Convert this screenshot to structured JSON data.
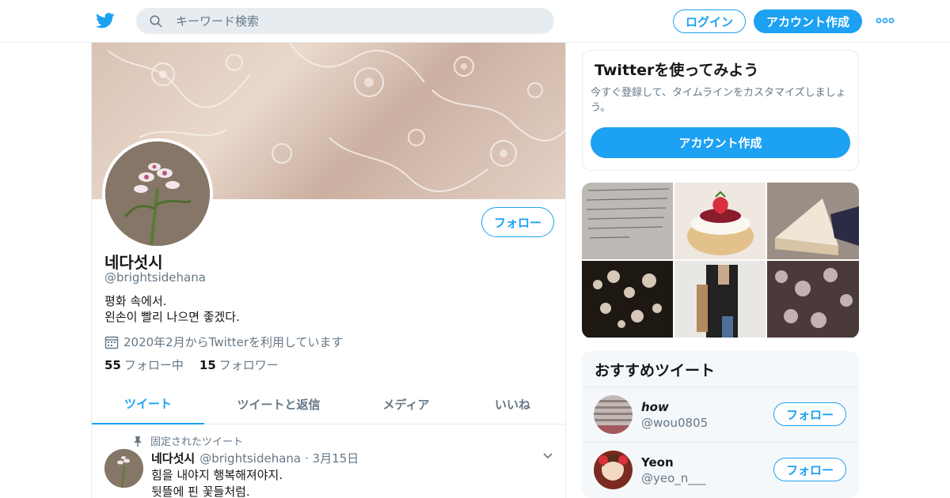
{
  "header": {
    "search_placeholder": "キーワード検索",
    "login_label": "ログイン",
    "signup_label": "アカウント作成"
  },
  "profile": {
    "name": "네다섯시",
    "handle": "@brightsidehana",
    "bio_line1": "평화 속에서.",
    "bio_line2": "왼손이 빨리 나으면 좋겠다.",
    "joined": "2020年2月からTwitterを利用しています",
    "following_count": "55",
    "following_label": "フォロー中",
    "followers_count": "15",
    "followers_label": "フォロワー",
    "follow_label": "フォロー"
  },
  "tabs": [
    {
      "label": "ツイート"
    },
    {
      "label": "ツイートと返信"
    },
    {
      "label": "メディア"
    },
    {
      "label": "いいね"
    }
  ],
  "pinned_tweet": {
    "pinned_label": "固定されたツイート",
    "name": "네다섯시",
    "handle": "@brightsidehana",
    "date": "· 3月15日",
    "line1": "힘을 내야지 행복해져야지.",
    "line2": "뒷뜰에 핀 꽃들처럼."
  },
  "signup_card": {
    "title": "Twitterを使ってみよう",
    "desc": "今すぐ登録して、タイムラインをカスタマイズしましょう。",
    "button": "アカウント作成"
  },
  "recommend": {
    "title": "おすすめツイート",
    "users": [
      {
        "name": "𝙝𝙤𝙬",
        "handle": "@wou0805",
        "follow_label": "フォロー"
      },
      {
        "name": "Yeon",
        "handle": "@yeo_n___",
        "follow_label": "フォロー"
      }
    ]
  },
  "colors": {
    "accent": "#1da1f2",
    "muted": "#657786",
    "border": "#e6ecf0"
  }
}
